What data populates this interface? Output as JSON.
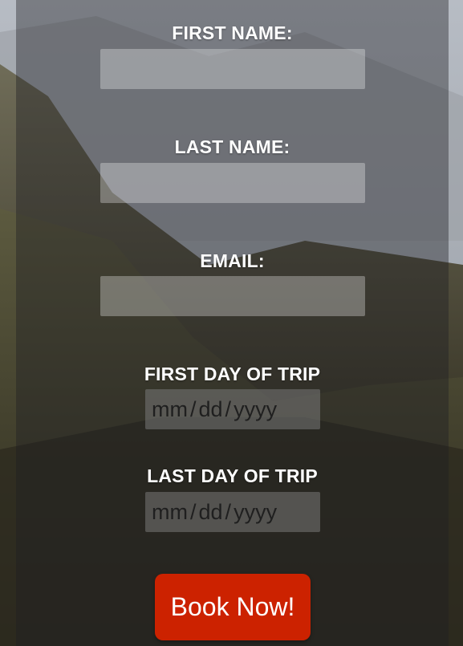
{
  "form": {
    "first_name": {
      "label": "FIRST NAME:",
      "value": "",
      "placeholder": ""
    },
    "last_name": {
      "label": "LAST NAME:",
      "value": "",
      "placeholder": ""
    },
    "email": {
      "label": "EMAIL:",
      "value": "",
      "placeholder": ""
    },
    "first_day": {
      "label": "FIRST DAY OF TRIP",
      "mm": "mm",
      "dd": "dd",
      "yyyy": "yyyy",
      "sep": "/"
    },
    "last_day": {
      "label": "LAST DAY OF TRIP",
      "mm": "mm",
      "dd": "dd",
      "yyyy": "yyyy",
      "sep": "/"
    },
    "submit_label": "Book Now!"
  },
  "colors": {
    "button": "#cc2200",
    "text": "#ffffff"
  }
}
